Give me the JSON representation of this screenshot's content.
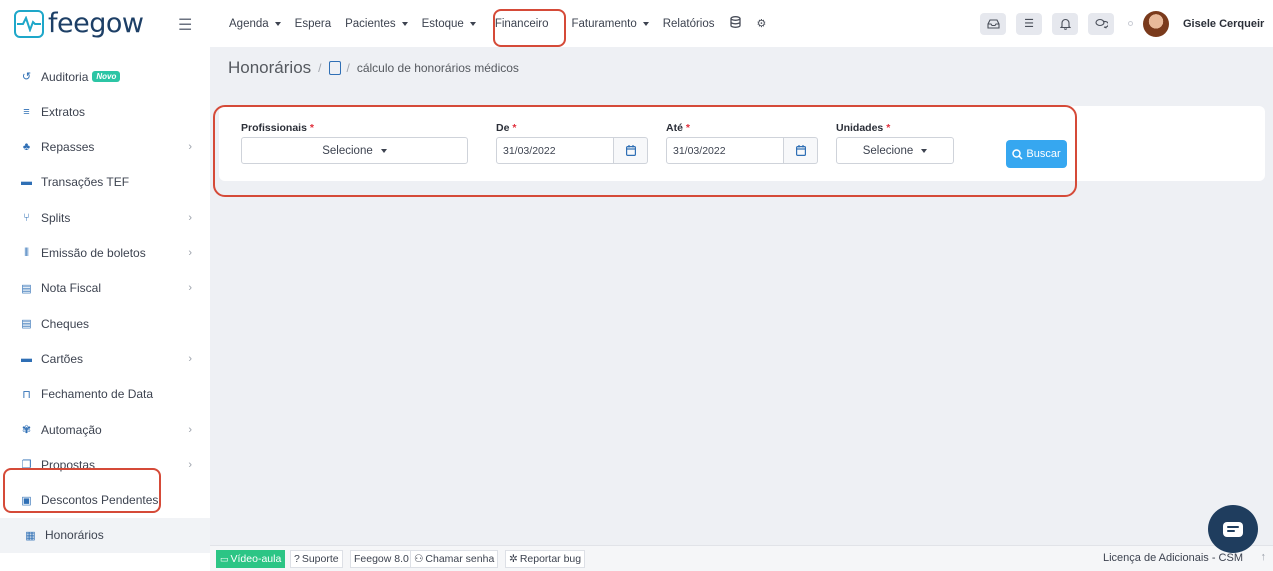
{
  "brand": {
    "name": "feegow"
  },
  "nav": {
    "items": [
      {
        "label": "Agenda",
        "dropdown": true
      },
      {
        "label": "Espera",
        "dropdown": false
      },
      {
        "label": "Pacientes",
        "dropdown": true
      },
      {
        "label": "Estoque",
        "dropdown": true
      },
      {
        "label": "Financeiro",
        "dropdown": false
      },
      {
        "label": "Faturamento",
        "dropdown": true
      },
      {
        "label": "Relatórios",
        "dropdown": false
      }
    ],
    "icons": [
      "database-icon",
      "gear-icon"
    ]
  },
  "topright": {
    "buttons": [
      "inbox-icon",
      "checklist-icon",
      "bell-icon",
      "chat-icon"
    ],
    "username": "Gisele Cerqueir"
  },
  "sidebar": {
    "items": [
      {
        "label": "Auditoria",
        "icon": "history-icon",
        "badge": "Novo",
        "chevron": false
      },
      {
        "label": "Extratos",
        "icon": "list-icon",
        "chevron": false
      },
      {
        "label": "Repasses",
        "icon": "hand-money-icon",
        "chevron": true
      },
      {
        "label": "Transações TEF",
        "icon": "card-icon",
        "chevron": false
      },
      {
        "label": "Splits",
        "icon": "split-icon",
        "chevron": true
      },
      {
        "label": "Emissão de boletos",
        "icon": "barcode-icon",
        "chevron": true
      },
      {
        "label": "Nota Fiscal",
        "icon": "document-icon",
        "chevron": true
      },
      {
        "label": "Cheques",
        "icon": "check-icon",
        "chevron": false
      },
      {
        "label": "Cartões",
        "icon": "card-icon",
        "chevron": true
      },
      {
        "label": "Fechamento de Data",
        "icon": "lock-icon",
        "chevron": false
      },
      {
        "label": "Automação",
        "icon": "gears-icon",
        "chevron": true
      },
      {
        "label": "Propostas",
        "icon": "copy-icon",
        "chevron": true
      },
      {
        "label": "Descontos Pendentes",
        "icon": "money-icon",
        "chevron": false
      },
      {
        "label": "Honorários",
        "icon": "calendar-icon",
        "chevron": false,
        "active": true
      }
    ]
  },
  "breadcrumb": {
    "title": "Honorários",
    "sub": "cálculo de honorários médicos"
  },
  "filters": {
    "profissionais": {
      "label": "Profissionais",
      "value": "Selecione"
    },
    "de": {
      "label": "De",
      "value": "31/03/2022"
    },
    "ate": {
      "label": "Até",
      "value": "31/03/2022"
    },
    "unidades": {
      "label": "Unidades",
      "value": "Selecione"
    },
    "required_mark": "*",
    "search_label": "Buscar"
  },
  "footer": {
    "video": "Vídeo-aula",
    "suporte": "Suporte",
    "version": "Feegow 8.0",
    "chamar": "Chamar senha",
    "reportar": "Reportar bug",
    "license": "Licença de Adicionais - CSM"
  },
  "colors": {
    "accent": "#36a7f0",
    "highlight": "#d54a38",
    "brand_text": "#1d3f66",
    "badge": "#2cc5a5"
  }
}
